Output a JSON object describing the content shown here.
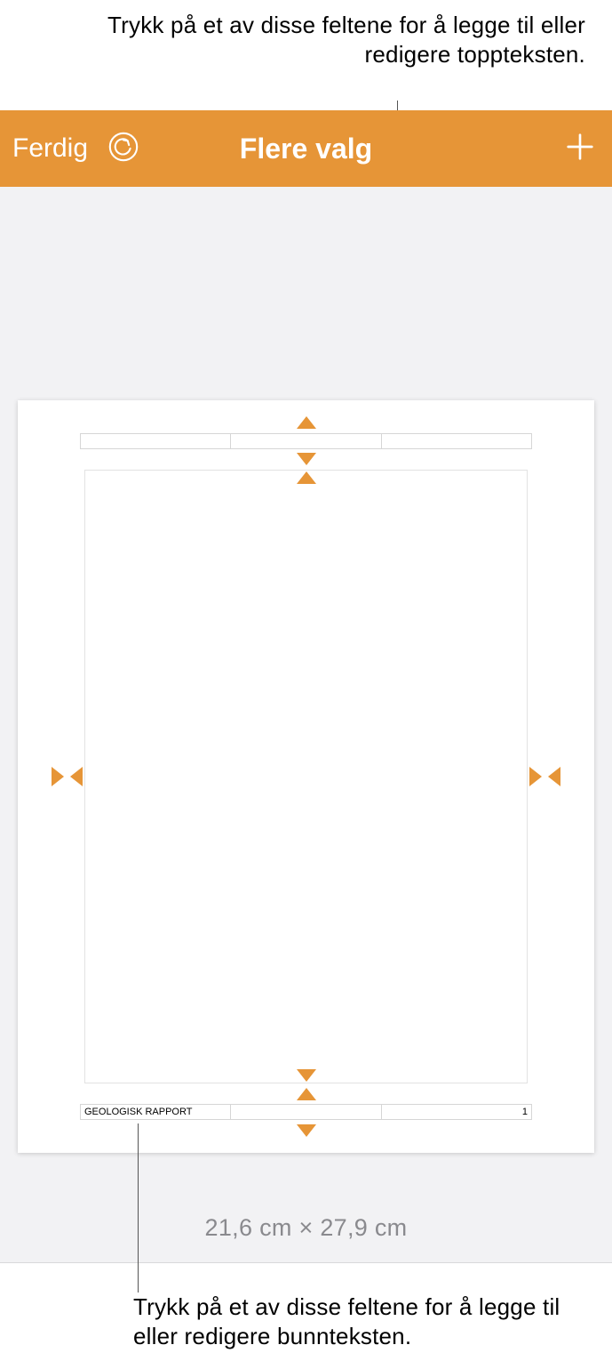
{
  "callouts": {
    "top": "Trykk på et av disse feltene for å legge til eller redigere toppteksten.",
    "bottom": "Trykk på et av disse feltene for å legge til eller redigere bunnteksten."
  },
  "toolbar": {
    "done_label": "Ferdig",
    "title": "Flere valg"
  },
  "document": {
    "header": {
      "left": "",
      "center": "",
      "right": ""
    },
    "footer": {
      "left": "GEOLOGISK RAPPORT",
      "center": "",
      "right": "1"
    },
    "dimensions": "21,6 cm × 27,9 cm"
  },
  "colors": {
    "accent": "#E69537"
  }
}
